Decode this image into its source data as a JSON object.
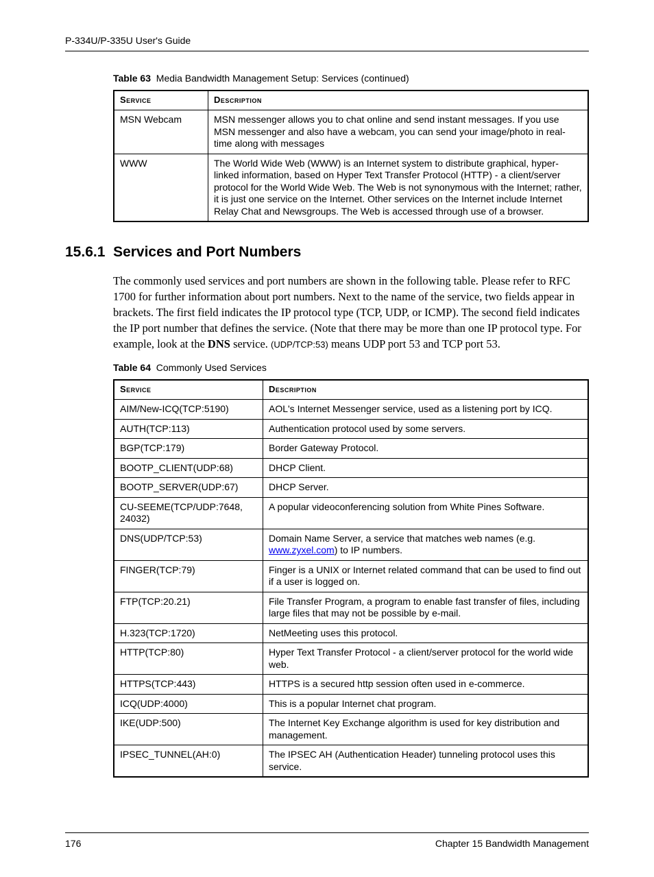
{
  "header": {
    "guide_title": "P-334U/P-335U User's Guide"
  },
  "table63": {
    "caption_label": "Table 63",
    "caption_text": "Media Bandwidth Management Setup: Services (continued)",
    "headers": {
      "service": "Service",
      "description": "Description"
    },
    "rows": [
      {
        "service": "MSN Webcam",
        "description": "MSN messenger allows you to chat online and send instant messages. If you use MSN messenger and also have a webcam, you can send your image/photo in real-time along with messages"
      },
      {
        "service": "WWW",
        "description": "The World Wide Web (WWW) is an Internet system to distribute graphical, hyper-linked information, based on Hyper Text Transfer Protocol (HTTP) - a client/server protocol for the World Wide Web. The Web is not synonymous with the Internet; rather, it is just one service on the Internet. Other services on the Internet include Internet Relay Chat and Newsgroups. The Web is accessed through use of a browser."
      }
    ]
  },
  "section": {
    "number": "15.6.1",
    "title": "Services and Port Numbers",
    "para_pre": "The commonly used services and port numbers are shown in the following table. Please refer to RFC 1700 for further information about port numbers. Next to the name of the service, two fields appear in brackets. The first field indicates the IP protocol type (TCP, UDP, or ICMP). The second field indicates the IP port number that defines the service. (Note that there may be more than one IP protocol type. For example, look at the ",
    "dns_bold": "DNS",
    "para_mid": " service. ",
    "udp_tcp_small": "(UDP/TCP:53)",
    "para_post": " means UDP port 53 and TCP port 53."
  },
  "table64": {
    "caption_label": "Table 64",
    "caption_text": "Commonly Used Services",
    "headers": {
      "service": "Service",
      "description": "Description"
    },
    "rows": [
      {
        "service": "AIM/New-ICQ(TCP:5190)",
        "description": "AOL's Internet Messenger service, used as a listening port by ICQ."
      },
      {
        "service": "AUTH(TCP:113)",
        "description": "Authentication protocol used by some servers."
      },
      {
        "service": "BGP(TCP:179)",
        "description": "Border Gateway Protocol."
      },
      {
        "service": "BOOTP_CLIENT(UDP:68)",
        "description": "DHCP Client."
      },
      {
        "service": "BOOTP_SERVER(UDP:67)",
        "description": "DHCP Server."
      },
      {
        "service": "CU-SEEME(TCP/UDP:7648, 24032)",
        "description": "A popular videoconferencing solution from White Pines Software."
      },
      {
        "service": "DNS(UDP/TCP:53)",
        "desc_pre": "Domain Name Server, a service that matches web names (e.g. ",
        "link": "www.zyxel.com",
        "desc_post": ") to IP numbers."
      },
      {
        "service": "FINGER(TCP:79)",
        "description": "Finger is a UNIX or Internet related command that can be used to find out if a user is logged on."
      },
      {
        "service": "FTP(TCP:20.21)",
        "description": "File Transfer Program, a program to enable fast transfer of files, including large files that may not be possible by e-mail."
      },
      {
        "service": "H.323(TCP:1720)",
        "description": "NetMeeting uses this protocol."
      },
      {
        "service": "HTTP(TCP:80)",
        "description": "Hyper Text Transfer Protocol - a client/server protocol for the world wide web."
      },
      {
        "service": "HTTPS(TCP:443)",
        "description": "HTTPS is a secured http session often used in e-commerce."
      },
      {
        "service": "ICQ(UDP:4000)",
        "description": "This is a popular Internet chat program."
      },
      {
        "service": "IKE(UDP:500)",
        "description": "The Internet Key Exchange algorithm is used for key distribution and management."
      },
      {
        "service": "IPSEC_TUNNEL(AH:0)",
        "description": "The IPSEC AH (Authentication Header) tunneling protocol uses this service."
      }
    ]
  },
  "footer": {
    "page": "176",
    "chapter": "Chapter 15 Bandwidth Management"
  }
}
